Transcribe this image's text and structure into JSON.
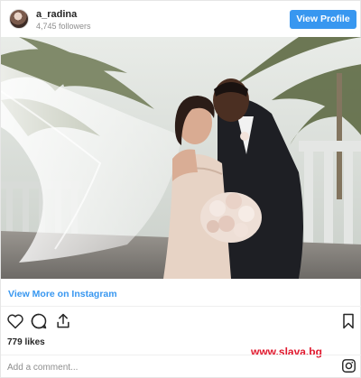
{
  "header": {
    "username": "a_radina",
    "followers": "4,745 followers",
    "view_profile_label": "View Profile"
  },
  "post": {
    "view_more_label": "View More on Instagram",
    "likes": "779 likes",
    "comment_placeholder": "Add a comment..."
  },
  "watermark": {
    "text": "www.slava.bg"
  },
  "icons": {
    "like": "heart-icon",
    "comment": "comment-icon",
    "share": "share-icon",
    "save": "bookmark-icon",
    "brand": "instagram-icon"
  },
  "colors": {
    "accent": "#3897f0",
    "watermark": "#e0182d",
    "text": "#262626",
    "muted": "#8e8e8e"
  }
}
